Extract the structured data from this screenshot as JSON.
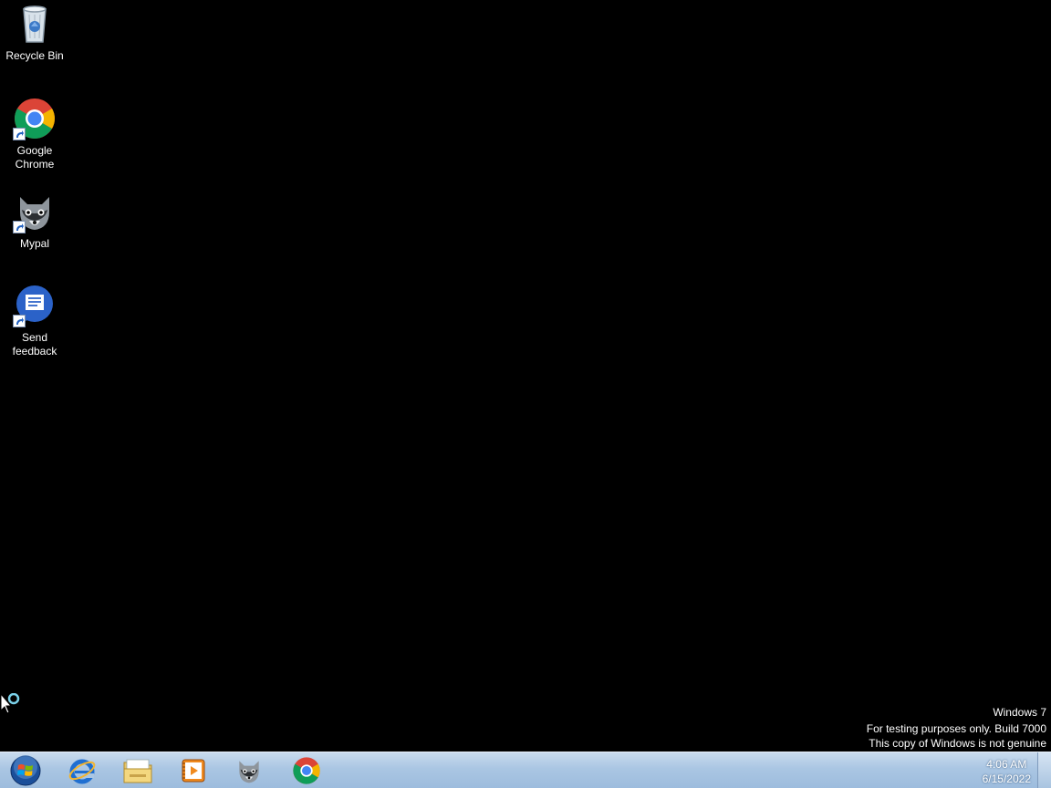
{
  "desktop": {
    "icons": [
      {
        "label": "Recycle Bin",
        "icon": "recycle-bin-icon"
      },
      {
        "label": "Google Chrome",
        "icon": "chrome-icon"
      },
      {
        "label": "Mypal",
        "icon": "mypal-raccoon-icon"
      },
      {
        "label": "Send feedback",
        "icon": "feedback-icon"
      }
    ],
    "watermark": {
      "line1": "Windows  7",
      "line2": "For testing purposes only. Build 7000",
      "line3": "This copy of Windows is not genuine"
    }
  },
  "taskbar": {
    "pinned": [
      {
        "name": "start",
        "icon": "windows-orb-icon"
      },
      {
        "name": "internet-explorer",
        "icon": "internet-explorer-icon"
      },
      {
        "name": "file-explorer",
        "icon": "folder-icon"
      },
      {
        "name": "media-player",
        "icon": "media-player-icon"
      },
      {
        "name": "mypal",
        "icon": "mypal-raccoon-icon"
      },
      {
        "name": "chrome",
        "icon": "chrome-icon"
      }
    ],
    "clock": {
      "time": "4:06 AM",
      "date": "6/15/2022"
    }
  },
  "colors": {
    "desktop_bg": "#000000",
    "taskbar_top": "#c9dbee",
    "taskbar_bottom": "#9dbcdd",
    "text": "#ffffff"
  }
}
